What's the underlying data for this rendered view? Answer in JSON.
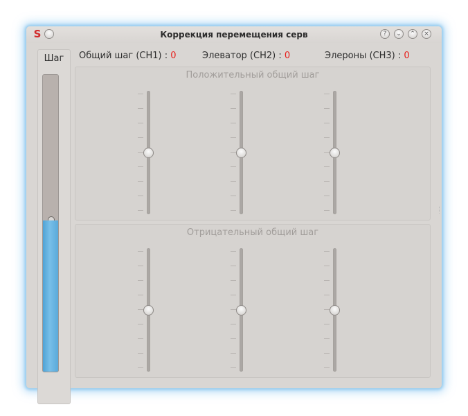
{
  "window": {
    "title": "Коррекция перемещения серв",
    "app_icon": "S",
    "buttons": {
      "help": "?",
      "minimize": "⌄",
      "maximize": "⌃",
      "close": "×"
    }
  },
  "pitch_panel": {
    "label": "Шаг",
    "level_percent": 51
  },
  "status": {
    "ch1_label": "Общий шаг (CH1) : ",
    "ch1_value": "0",
    "ch2_label": "Элеватор (CH2) : ",
    "ch2_value": "0",
    "ch3_label": "Элероны (CH3) : ",
    "ch3_value": "0"
  },
  "groups": [
    {
      "title": "Положительный общий шаг",
      "sliders": [
        0.5,
        0.5,
        0.5
      ]
    },
    {
      "title": "Отрицательный общий шаг",
      "sliders": [
        0.5,
        0.5,
        0.5
      ]
    }
  ],
  "colors": {
    "accent": "#5aa9da",
    "value": "#e8201c",
    "glow": "#8fc9ee"
  }
}
